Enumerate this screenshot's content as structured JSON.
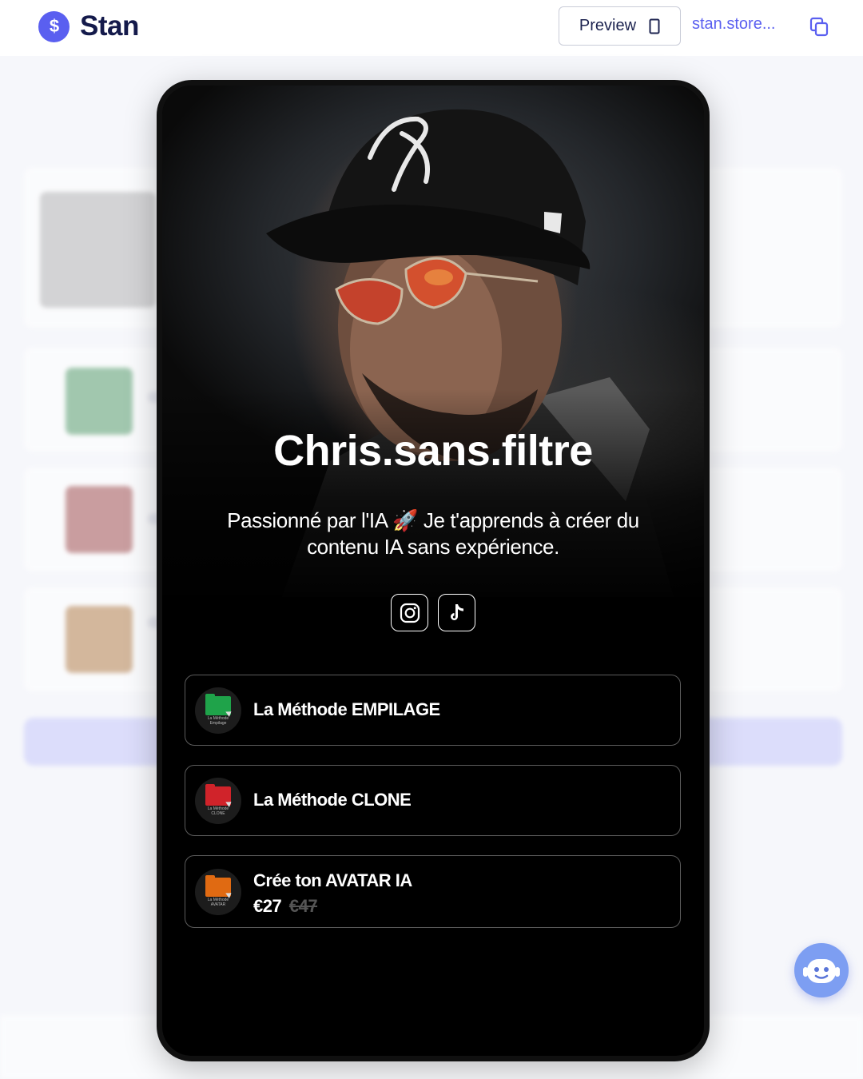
{
  "app": {
    "brand_name": "Stan",
    "brand_color": "#5a5ff0"
  },
  "toolbar": {
    "preview_label": "Preview",
    "store_link": "stan.store...",
    "icons": [
      "dollar-icon",
      "phone-icon",
      "copy-icon"
    ]
  },
  "profile": {
    "name": "Chris.sans.filtre",
    "bio_line1": "Passionné par l'IA 🚀 Je t'apprends à créer du",
    "bio_line2": "contenu IA sans expérience.",
    "socials": [
      "instagram-icon",
      "tiktok-icon"
    ]
  },
  "products": [
    {
      "title": "La Méthode EMPILAGE",
      "thumb_caption": "La Méthode Empilage",
      "folder_color": "#1fa34a"
    },
    {
      "title": "La Méthode CLONE",
      "thumb_caption": "La Méthode CLONE",
      "folder_color": "#d0232a"
    },
    {
      "title": "Crée ton AVATAR IA",
      "thumb_caption": "La Méthode AVATAR",
      "folder_color": "#e06a12",
      "price": "€27",
      "old_price": "€47"
    }
  ],
  "helper": {
    "icon": "chat-bot-icon",
    "color": "#7d9ef2"
  }
}
